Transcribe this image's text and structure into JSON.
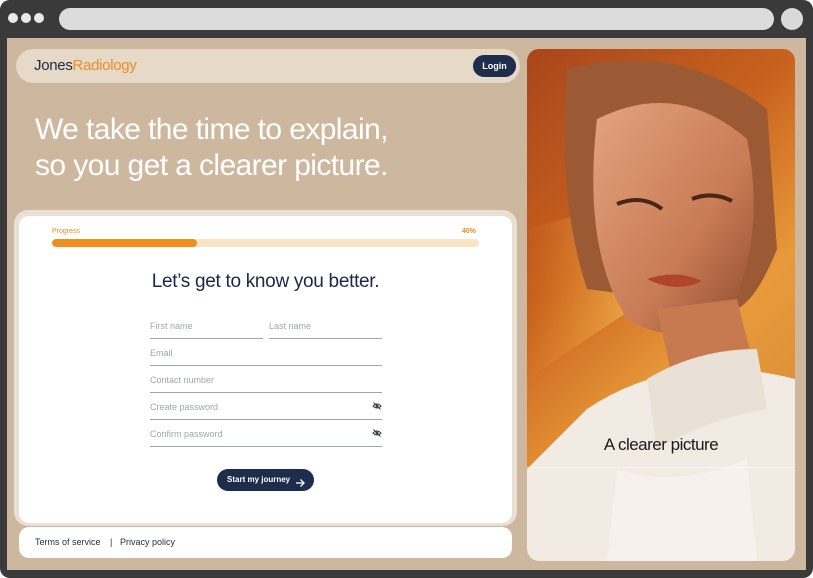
{
  "brand": {
    "name_part1": "Jones",
    "name_part2": "Radiology",
    "accent_color": "#ec8c21",
    "navy_color": "#1f2d4d"
  },
  "header": {
    "login_label": "Login"
  },
  "hero": {
    "line1": "We take the time to explain,",
    "line2": "so you get a clearer picture."
  },
  "progress": {
    "label": "Progress",
    "percent_text": "40%",
    "value": 0.34
  },
  "form": {
    "title": "Let’s get to know you better.",
    "first_name_placeholder": "First name",
    "last_name_placeholder": "Last name",
    "email_placeholder": "Email",
    "contact_placeholder": "Contact number",
    "password_placeholder": "Create password",
    "confirm_password_placeholder": "Confirm password",
    "submit_label": "Start my journey"
  },
  "footer": {
    "terms": "Terms of service",
    "separator": "|",
    "privacy": "Privacy policy"
  },
  "side_image": {
    "caption": "A clearer picture"
  },
  "icons": {
    "password_toggle": "eye-slash-icon",
    "submit_arrow": "arrow-right-icon"
  }
}
